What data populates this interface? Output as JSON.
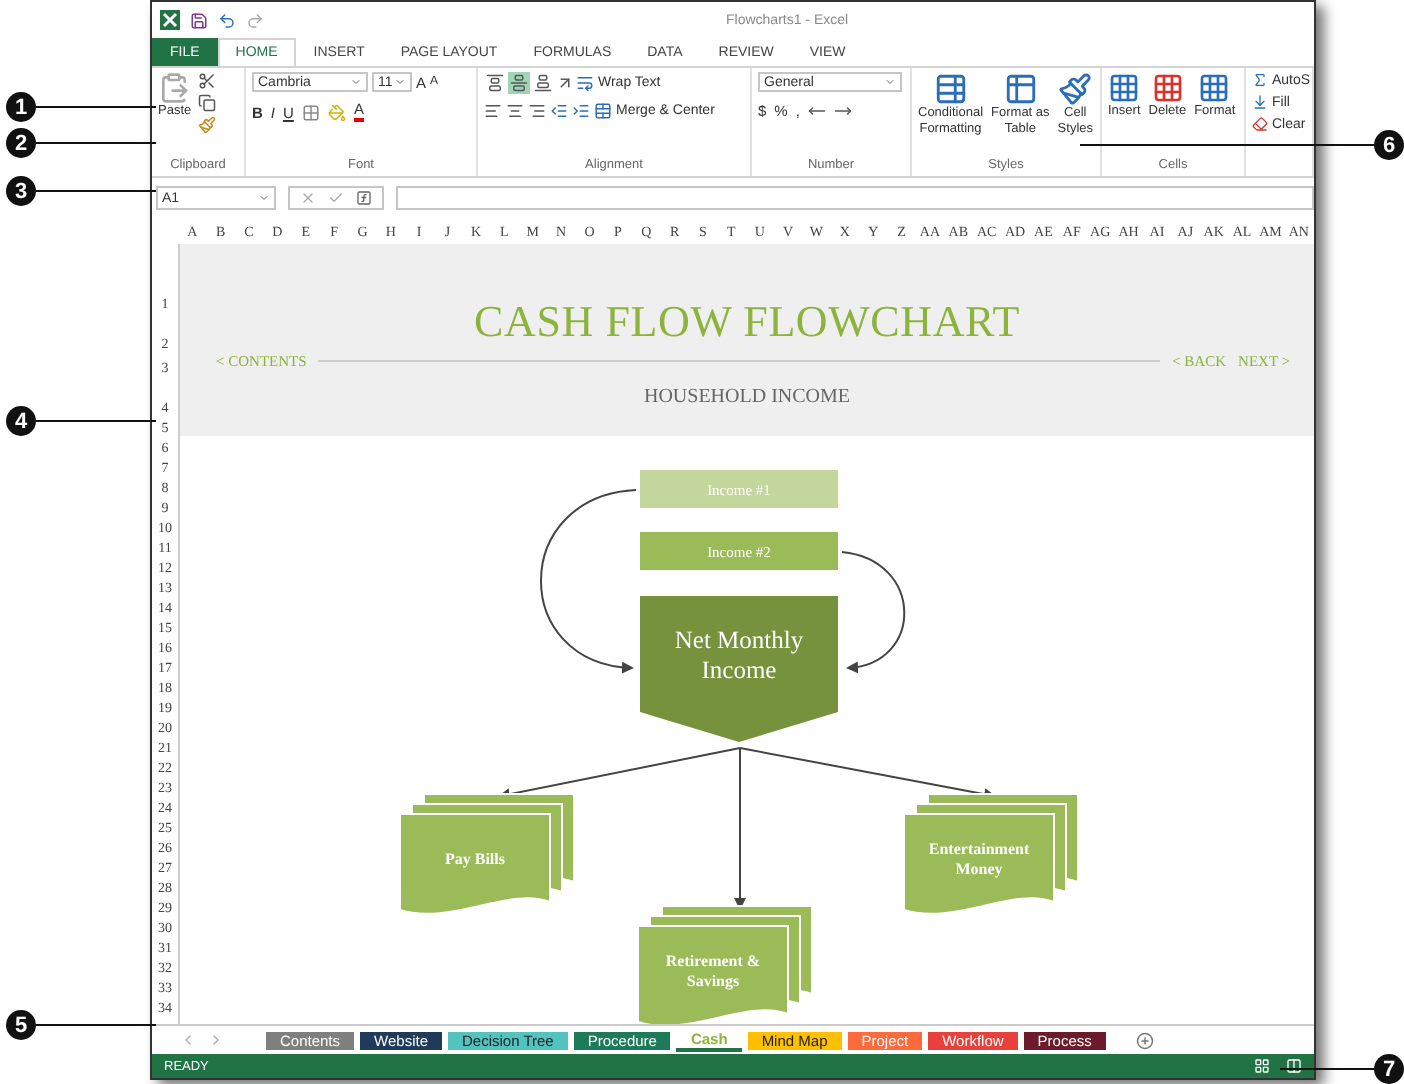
{
  "window": {
    "title": "Flowcharts1 - Excel"
  },
  "ribbon_tabs": [
    {
      "label": "FILE",
      "kind": "backstage",
      "selected": false
    },
    {
      "label": "HOME",
      "kind": "tab",
      "selected": true
    },
    {
      "label": "INSERT",
      "kind": "tab",
      "selected": false
    },
    {
      "label": "PAGE LAYOUT",
      "kind": "tab",
      "selected": false
    },
    {
      "label": "FORMULAS",
      "kind": "tab",
      "selected": false
    },
    {
      "label": "DATA",
      "kind": "tab",
      "selected": false
    },
    {
      "label": "REVIEW",
      "kind": "tab",
      "selected": false
    },
    {
      "label": "VIEW",
      "kind": "tab",
      "selected": false
    }
  ],
  "ribbon": {
    "clipboard": {
      "label": "Clipboard",
      "paste": "Paste"
    },
    "font": {
      "label": "Font",
      "font_name": "Cambria",
      "font_size": "11",
      "grow": "A",
      "shrink": "A",
      "styles": [
        "B",
        "I",
        "U"
      ],
      "font_color": "A"
    },
    "alignment": {
      "label": "Alignment",
      "vertical": [
        {
          "selected": false
        },
        {
          "selected": true
        },
        {
          "selected": false
        }
      ],
      "wrap_text": "Wrap Text",
      "merge": "Merge & Center"
    },
    "number": {
      "label": "Number",
      "format": "General",
      "symbols": [
        "$",
        "%",
        ","
      ]
    },
    "styles": {
      "label": "Styles",
      "buttons": [
        {
          "lines": [
            "Conditional",
            "Formatting"
          ]
        },
        {
          "lines": [
            "Format as",
            "Table"
          ]
        },
        {
          "lines": [
            "Cell",
            "Styles"
          ]
        }
      ]
    },
    "cells": {
      "label": "Cells",
      "buttons": [
        "Insert",
        "Delete",
        "Format"
      ]
    },
    "editing": {
      "buttons": [
        "AutoS",
        "Fill",
        "Clear"
      ]
    }
  },
  "formula_bar": {
    "name_box": "A1"
  },
  "columns": [
    "A",
    "B",
    "C",
    "D",
    "E",
    "F",
    "G",
    "H",
    "I",
    "J",
    "K",
    "L",
    "M",
    "N",
    "O",
    "P",
    "Q",
    "R",
    "S",
    "T",
    "U",
    "V",
    "W",
    "X",
    "Y",
    "Z",
    "AA",
    "AB",
    "AC",
    "AD",
    "AE",
    "AF",
    "AG",
    "AH",
    "AI",
    "AJ",
    "AK",
    "AL",
    "AM",
    "AN"
  ],
  "rows": [
    "1",
    "2",
    "3",
    "4",
    "5",
    "6",
    "7",
    "8",
    "9",
    "10",
    "11",
    "12",
    "13",
    "14",
    "15",
    "16",
    "17",
    "18",
    "19",
    "20",
    "21",
    "22",
    "23",
    "24",
    "25",
    "26",
    "27",
    "28",
    "29",
    "30",
    "31",
    "32",
    "33",
    "34"
  ],
  "banner": {
    "title": "CASH FLOW FLOWCHART",
    "nav_left": "< CONTENTS",
    "nav_right": [
      "< BACK",
      "NEXT >"
    ],
    "subtitle": "HOUSEHOLD INCOME"
  },
  "flowchart": {
    "sources": [
      {
        "label": "Income #1",
        "color": "#c3d69b"
      },
      {
        "label": "Income #2",
        "color": "#9bbb59"
      }
    ],
    "hub": {
      "lines": [
        "Net Monthly",
        "Income"
      ]
    },
    "outputs": [
      {
        "lines": [
          "Pay Bills"
        ]
      },
      {
        "lines": [
          "Retirement &",
          "Savings"
        ]
      },
      {
        "lines": [
          "Entertainment",
          "Money"
        ]
      }
    ]
  },
  "sheet_tabs": [
    {
      "label": "Contents",
      "color": "#7f7f7f",
      "selected": false
    },
    {
      "label": "Website",
      "color": "#1f3a5a",
      "selected": false
    },
    {
      "label": "Decision Tree",
      "color": "#53c3c0",
      "selected": false
    },
    {
      "label": "Procedure",
      "color": "#1e7b5a",
      "selected": false
    },
    {
      "label": "Cash",
      "color": "#8cb33c",
      "selected": true
    },
    {
      "label": "Mind Map",
      "color": "#ffc000",
      "selected": false
    },
    {
      "label": "Project",
      "color": "#ff6a3d",
      "selected": false
    },
    {
      "label": "Workflow",
      "color": "#e8413c",
      "selected": false
    },
    {
      "label": "Process",
      "color": "#6d1a2a",
      "selected": false
    }
  ],
  "status_bar": {
    "text": "READY"
  },
  "callouts": [
    "1",
    "2",
    "3",
    "4",
    "5",
    "6",
    "7"
  ]
}
